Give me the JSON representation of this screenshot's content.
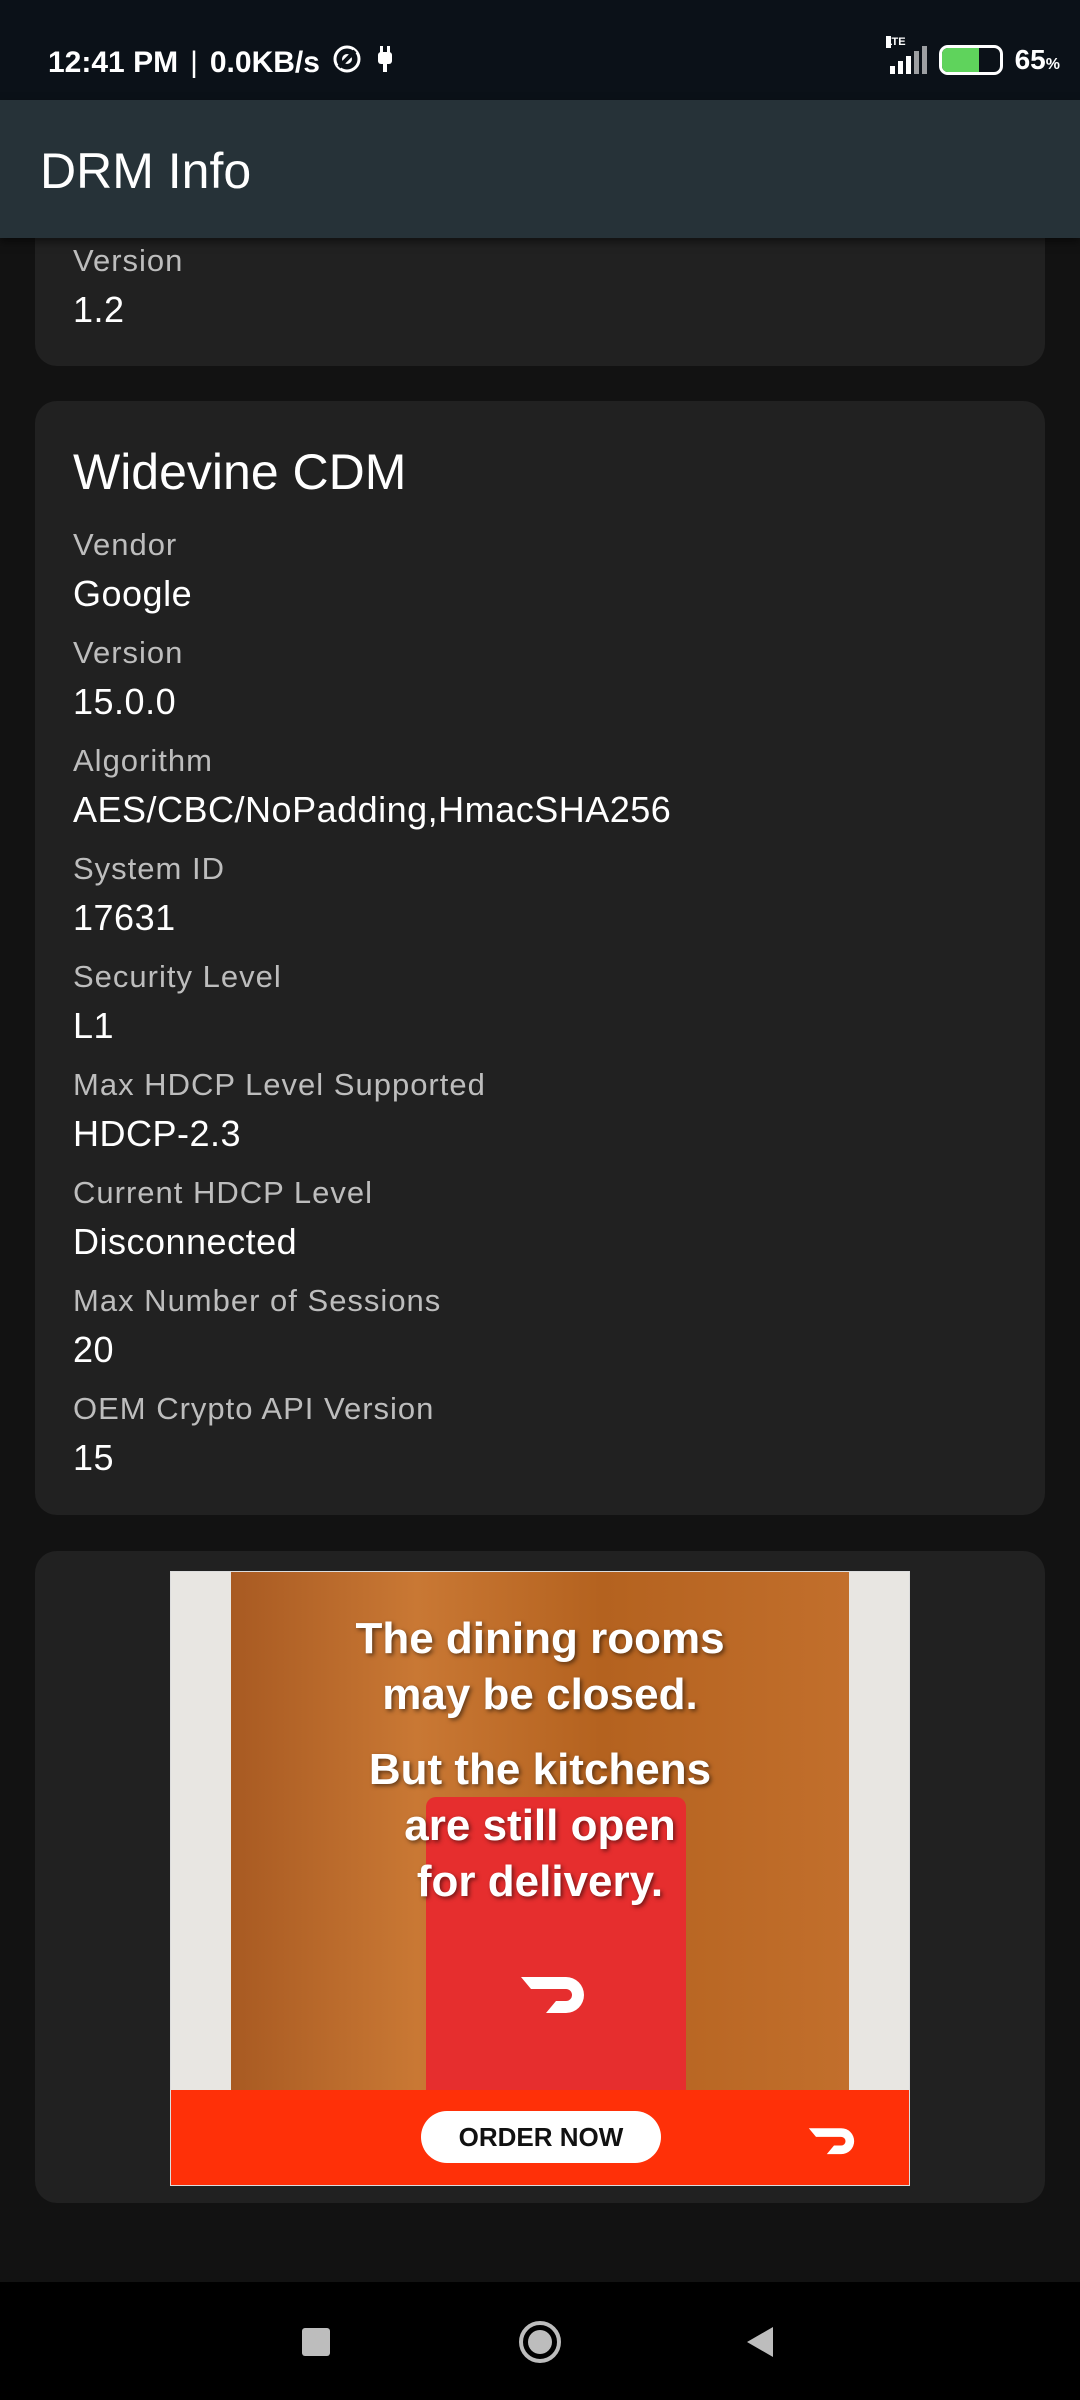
{
  "status_bar": {
    "time": "12:41 PM",
    "speed": "0.0KB/s",
    "network": "LTE",
    "battery_level": 65,
    "battery_pct": "65",
    "battery_symbol": "%"
  },
  "app_bar": {
    "title": "DRM Info"
  },
  "top_card": {
    "fields": [
      {
        "label": "Version",
        "value": "1.2"
      }
    ]
  },
  "widevine_card": {
    "title": "Widevine CDM",
    "fields": [
      {
        "label": "Vendor",
        "value": "Google"
      },
      {
        "label": "Version",
        "value": "15.0.0"
      },
      {
        "label": "Algorithm",
        "value": "AES/CBC/NoPadding,HmacSHA256"
      },
      {
        "label": "System ID",
        "value": "17631"
      },
      {
        "label": "Security Level",
        "value": "L1"
      },
      {
        "label": "Max HDCP Level Supported",
        "value": "HDCP-2.3"
      },
      {
        "label": "Current HDCP Level",
        "value": "Disconnected"
      },
      {
        "label": "Max Number of Sessions",
        "value": "20"
      },
      {
        "label": "OEM Crypto API Version",
        "value": "15"
      }
    ]
  },
  "ad": {
    "lines": [
      "The dining rooms",
      "may be closed.",
      "But the kitchens",
      "are still open",
      "for delivery."
    ],
    "button_label": "ORDER NOW",
    "brand_color": "#ff3008"
  },
  "nav_bar": {
    "icons": [
      "recents-square-icon",
      "home-circle-icon",
      "back-triangle-icon"
    ]
  }
}
